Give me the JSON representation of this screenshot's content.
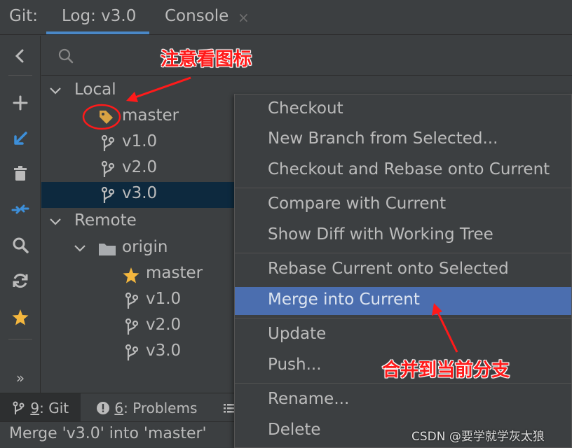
{
  "topbar": {
    "git_label": "Git:",
    "tabs": [
      {
        "label": "Log: v3.0"
      },
      {
        "label": "Console"
      }
    ],
    "close_glyph": "×"
  },
  "toolbar": {
    "icons": [
      "back-icon",
      "add-icon",
      "checkout-icon",
      "delete-icon",
      "compare-icon",
      "search-icon",
      "refresh-icon",
      "favorite-icon",
      "more-icon"
    ],
    "more_glyph": "»"
  },
  "tree": {
    "local": {
      "label": "Local",
      "branches": [
        "master",
        "v1.0",
        "v2.0",
        "v3.0"
      ]
    },
    "remote": {
      "label": "Remote",
      "origin": {
        "label": "origin",
        "branches": [
          "master",
          "v1.0",
          "v2.0",
          "v3.0"
        ]
      }
    },
    "selected_branch": "v3.0"
  },
  "annotations": {
    "icon_note": "注意看图标",
    "merge_note": "合并到当前分支"
  },
  "context_menu": {
    "items": [
      "Checkout",
      "New Branch from Selected...",
      "Checkout and Rebase onto Current",
      "Compare with Current",
      "Show Diff with Working Tree",
      "Rebase Current onto Selected",
      "Merge into Current",
      "Update",
      "Push...",
      "Rename...",
      "Delete"
    ],
    "highlighted": "Merge into Current"
  },
  "bottom_tabs": [
    {
      "number": "9",
      "label": ": Git"
    },
    {
      "number": "6",
      "label": ": Problems"
    }
  ],
  "status": {
    "text": "Merge 'v3.0' into 'master'"
  },
  "watermark": "CSDN @要学就学灰太狼",
  "colors": {
    "background": "#3c3f41",
    "selection": "#0d293e",
    "menu_highlight": "#4b6eaf",
    "annotation": "#ff1a1a",
    "tag_icon": "#d9a343",
    "star": "#f4b73e",
    "accent_blue": "#4a88c7"
  }
}
